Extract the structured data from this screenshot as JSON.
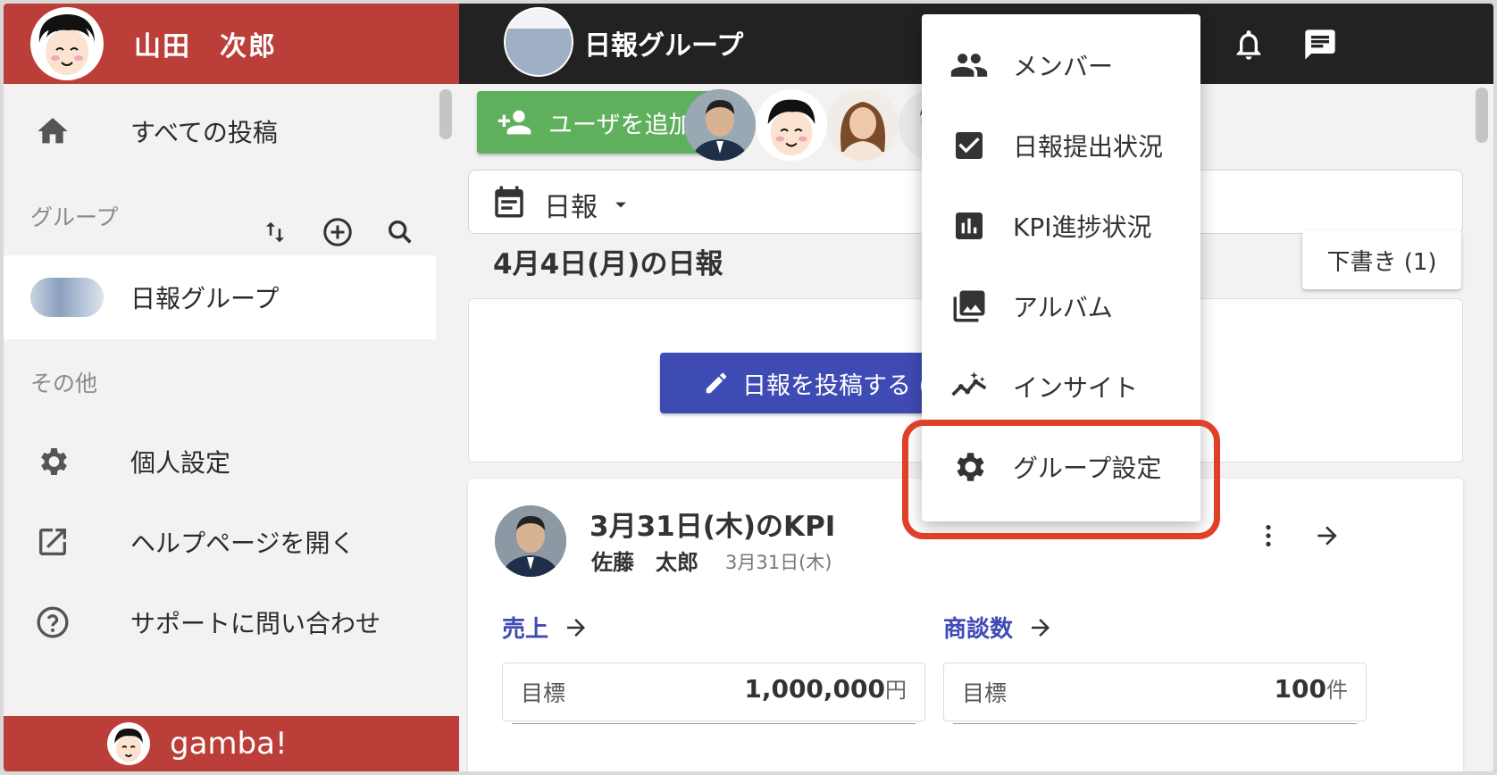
{
  "user": {
    "name": "山田　次郎"
  },
  "sidebar": {
    "items": [
      {
        "label": "すべての投稿",
        "icon": "home-icon"
      }
    ],
    "group_section": "グループ",
    "groups": [
      {
        "label": "日報グループ"
      }
    ],
    "other_section": "その他",
    "other_items": [
      {
        "label": "個人設定",
        "icon": "gear-icon"
      },
      {
        "label": "ヘルプページを開く",
        "icon": "open-in-new-icon"
      },
      {
        "label": "サポートに問い合わせ",
        "icon": "help-circle-icon"
      }
    ],
    "brand": "gamba!"
  },
  "topbar": {
    "title": "日報グループ"
  },
  "main": {
    "add_user_label": "ユーザを追加",
    "report_type": "日報",
    "date_heading": "4月4日(月)の日報",
    "draft_label": "下書き (1)",
    "post_button_label": "日報を投稿する (テンプレート)"
  },
  "kpi_card": {
    "title": "3月31日(木)のKPI",
    "author": "佐藤　太郎",
    "date": "3月31日(木)",
    "metrics": [
      {
        "name": "売上",
        "key": "目標",
        "value": "1,000,000",
        "unit": "円"
      },
      {
        "name": "商談数",
        "key": "目標",
        "value": "100",
        "unit": "件"
      }
    ]
  },
  "menu": {
    "items": [
      {
        "label": "メンバー",
        "icon": "people-icon"
      },
      {
        "label": "日報提出状況",
        "icon": "checkbox-icon"
      },
      {
        "label": "KPI進捗状況",
        "icon": "bar-chart-icon"
      },
      {
        "label": "アルバム",
        "icon": "photo-library-icon"
      },
      {
        "label": "インサイト",
        "icon": "insights-icon"
      },
      {
        "label": "グループ設定",
        "icon": "gear-icon"
      }
    ],
    "highlighted": "グループ設定"
  },
  "colors": {
    "brand_red": "#bb3f38",
    "topbar": "#222222",
    "accent_blue": "#3f4bb4",
    "add_green": "#5eb05c",
    "highlight": "#e04028"
  }
}
